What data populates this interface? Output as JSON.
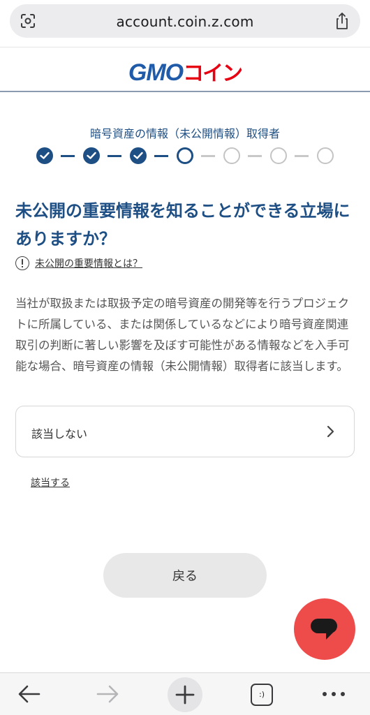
{
  "browser": {
    "url": "account.coin.z.com",
    "icons": {
      "site": "screenshot-lens-icon",
      "share": "share-icon"
    }
  },
  "header": {
    "logo_text": "GMO",
    "logo_kana": "コイン",
    "colors": {
      "brand_blue": "#1f5ba8",
      "brand_red": "#e60012"
    }
  },
  "stepper": {
    "title": "暗号資産の情報（未公開情報）取得者",
    "total_steps": 7,
    "completed_steps": 3,
    "current_step": 4,
    "accent": "#1e4f84"
  },
  "question": {
    "title": "未公開の重要情報を知ることができる立場にありますか？",
    "help_link": "未公開の重要情報とは？",
    "description": "当社が取扱または取扱予定の暗号資産の開発等を行うプロジェクトに所属している、または関係しているなどにより暗号資産関連取引の判断に著しい影響を及ぼす可能性がある情報などを入手可能な場合、暗号資産の情報（未公開情報）取得者に該当します。"
  },
  "options": {
    "primary_label": "該当しない",
    "secondary_label": "該当する"
  },
  "actions": {
    "back_label": "戻る"
  },
  "chat": {
    "icon": "chat-bubble-icon",
    "color": "#ee4b4b"
  },
  "toolbar": {
    "tabs_label": ":)",
    "icons": [
      "back-arrow-icon",
      "forward-arrow-icon",
      "plus-icon",
      "tabs-icon",
      "more-icon"
    ]
  }
}
